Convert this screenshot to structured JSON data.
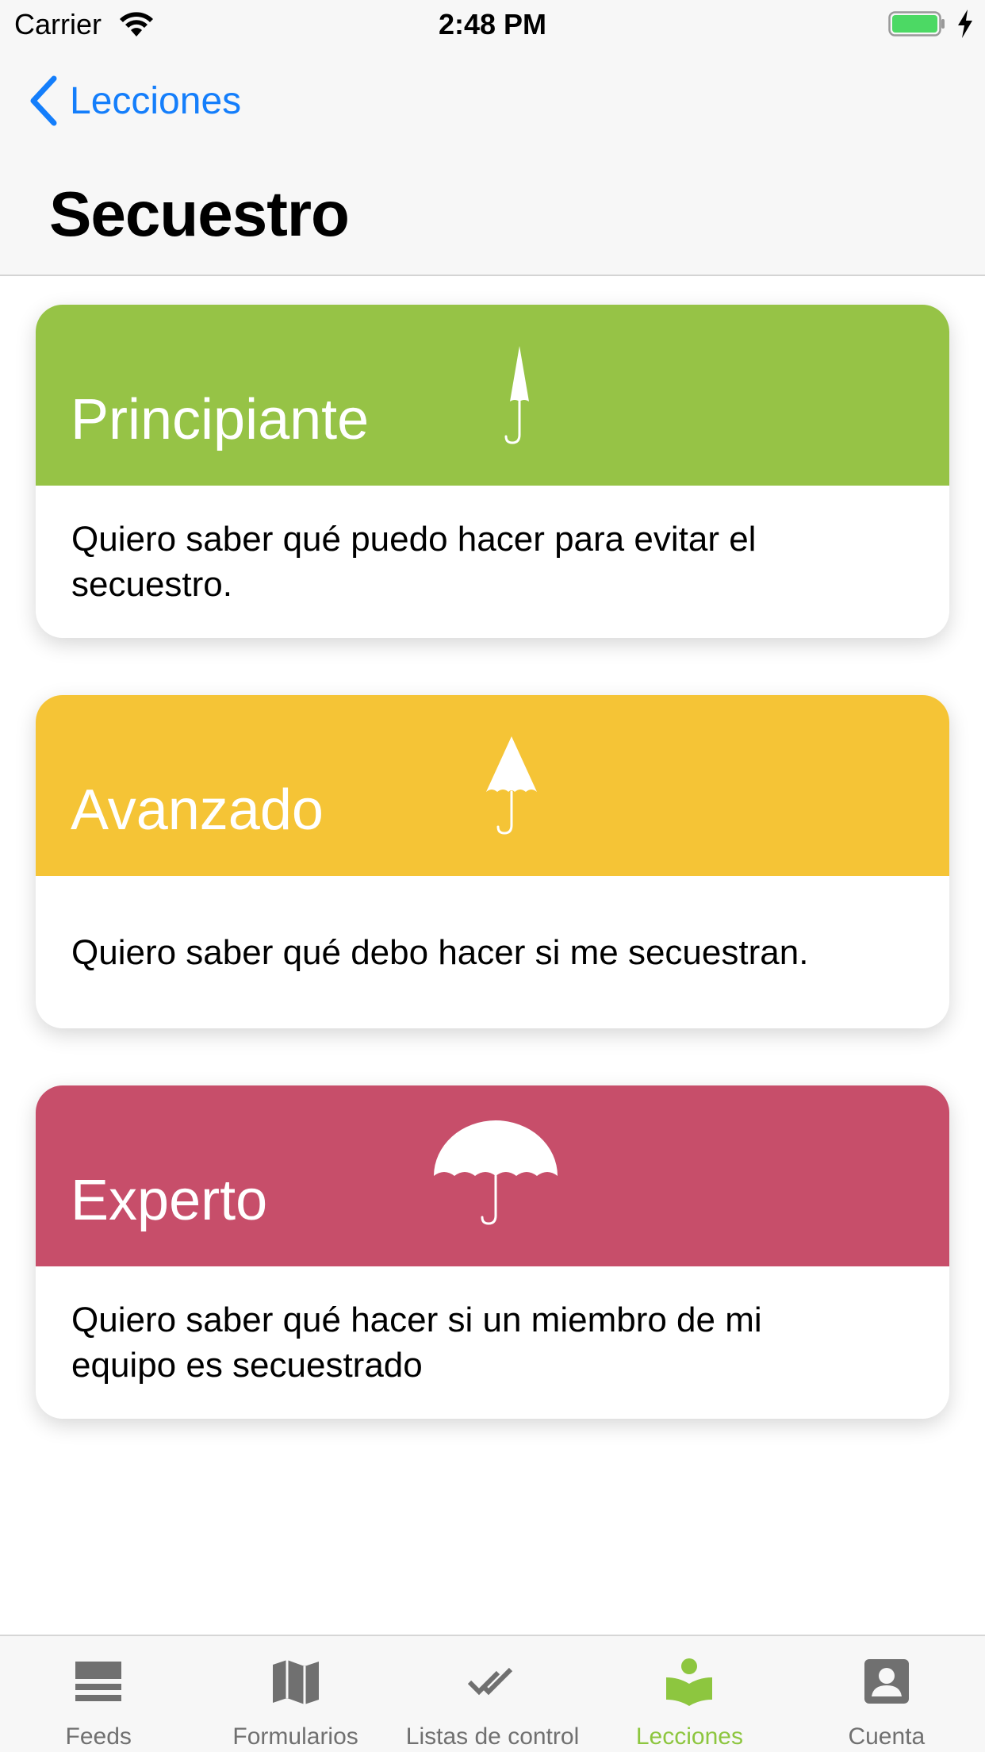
{
  "status_bar": {
    "carrier": "Carrier",
    "time": "2:48 PM",
    "battery_color": "#4cd964"
  },
  "nav": {
    "back_label": "Lecciones",
    "title": "Secuestro",
    "accent": "#147efb"
  },
  "cards": [
    {
      "level": "Principiante",
      "description": "Quiero saber qué puedo hacer para evitar el secuestro.",
      "color": "#96c346",
      "icon": "umbrella-closed-icon"
    },
    {
      "level": "Avanzado",
      "description": "Quiero saber qué debo hacer si me secuestran.",
      "color": "#f5c436",
      "icon": "umbrella-half-open-icon"
    },
    {
      "level": "Experto",
      "description": "Quiero saber qué hacer si un miembro de mi equipo es secuestrado",
      "color": "#c74e6a",
      "icon": "umbrella-open-icon"
    }
  ],
  "tab_bar": {
    "active_color": "#8dc63f",
    "inactive_color": "#707070",
    "tabs": [
      {
        "label": "Feeds",
        "icon": "feeds-icon"
      },
      {
        "label": "Formularios",
        "icon": "map-icon"
      },
      {
        "label": "Listas de control",
        "icon": "double-check-icon"
      },
      {
        "label": "Lecciones",
        "icon": "reader-book-icon",
        "active": true
      },
      {
        "label": "Cuenta",
        "icon": "account-icon"
      }
    ]
  }
}
